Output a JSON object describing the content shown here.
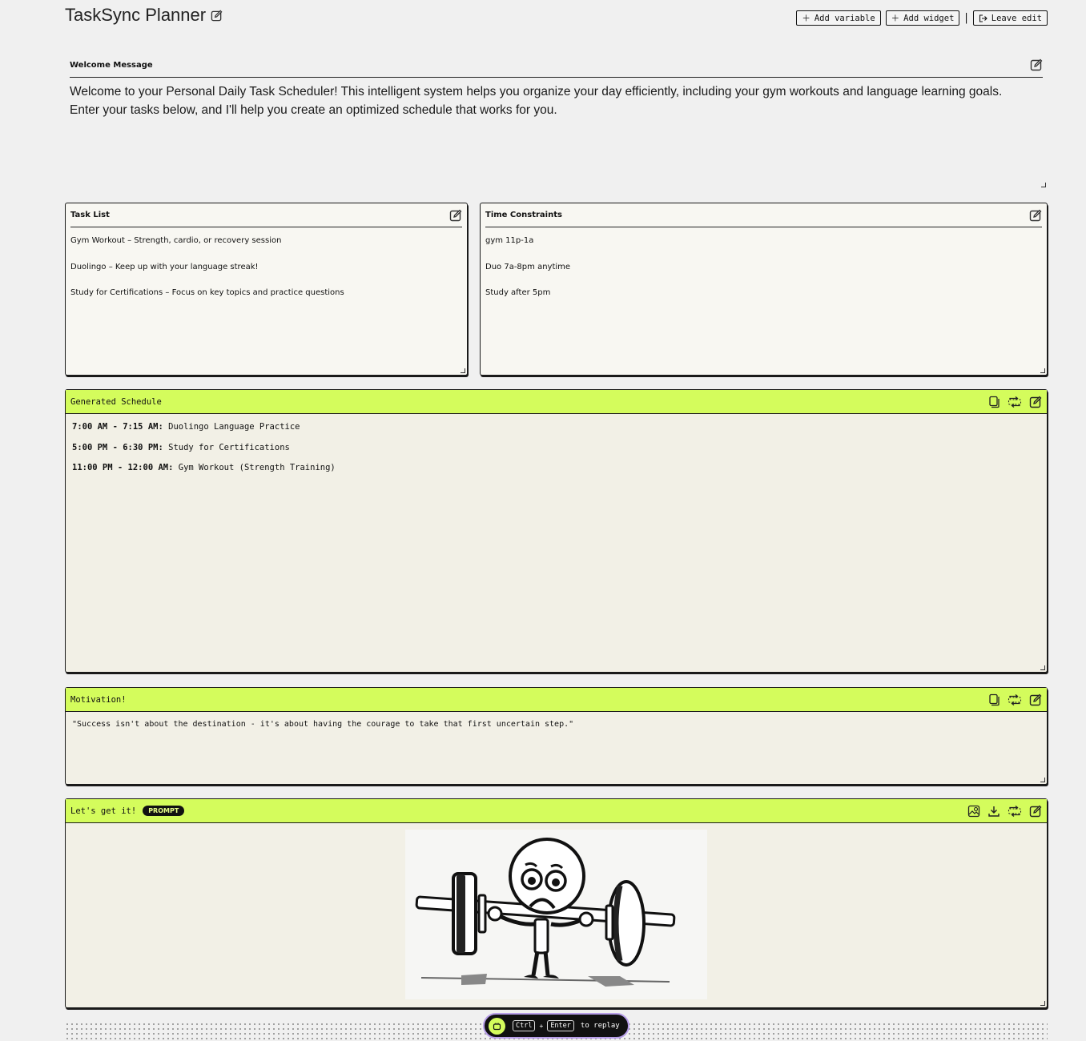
{
  "app": {
    "title": "TaskSync Planner"
  },
  "toolbar": {
    "add_variable": "Add variable",
    "add_widget": "Add widget",
    "separator": "|",
    "leave_edit": "Leave edit"
  },
  "welcome": {
    "label": "Welcome Message",
    "line1": "Welcome to your Personal Daily Task Scheduler! This intelligent system helps you organize your day efficiently, including your gym workouts and language learning goals.",
    "line2": "Enter your tasks below, and I'll help you create an optimized schedule that works for you."
  },
  "task_list": {
    "title": "Task List",
    "items": [
      "Gym Workout – Strength, cardio, or recovery session",
      "Duolingo – Keep up with your language streak!",
      "Study for Certifications – Focus on key topics and practice questions"
    ]
  },
  "time_constraints": {
    "title": "Time Constraints",
    "items": [
      "gym 11p-1a",
      "Duo 7a-8pm anytime",
      "Study after 5pm"
    ]
  },
  "schedule": {
    "title": "Generated Schedule",
    "entries": [
      {
        "time": "7:00 AM - 7:15 AM",
        "task": "Duolingo Language Practice"
      },
      {
        "time": "5:00 PM - 6:30 PM",
        "task": "Study for Certifications"
      },
      {
        "time": "11:00 PM - 12:00 AM",
        "task": "Gym Workout (Strength Training)"
      }
    ]
  },
  "motivation": {
    "title": "Motivation!",
    "quote": "\"Success isn't about the destination - it's about having the courage to take that first uncertain step.\""
  },
  "image_panel": {
    "title": "Let's get it!",
    "badge": "PROMPT"
  },
  "replay_bar": {
    "key1": "Ctrl",
    "plus": "+",
    "key2": "Enter",
    "text": "to replay"
  },
  "colors": {
    "accent": "#d4fc5c",
    "panel_bg": "#f2f0e6",
    "card_bg": "#f8f7f2",
    "page_bg": "#f0f0f0",
    "replay_border": "#b79ee8"
  }
}
